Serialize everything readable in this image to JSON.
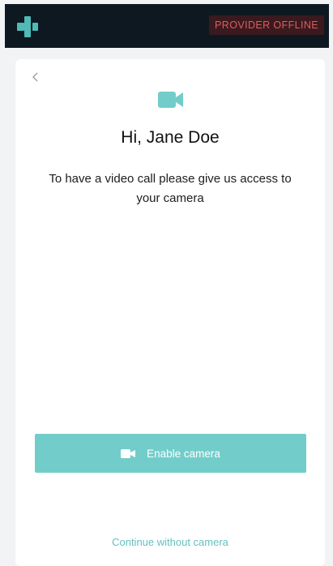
{
  "topbar": {
    "logo_icon": "plus-cross-logo-icon",
    "status_badge": "PROVIDER OFFLINE",
    "status_color": "#e05b5b"
  },
  "card": {
    "back_icon": "chevron-left-icon",
    "top_icon": "video-camera-icon",
    "greeting": "Hi, Jane Doe",
    "explanation": "To have a video call please give us access to your camera",
    "enable_button_label": "Enable camera",
    "enable_button_icon": "video-camera-icon",
    "continue_link": "Continue without camera"
  },
  "colors": {
    "accent": "#72cdca",
    "topbar_bg": "#0e1820"
  }
}
